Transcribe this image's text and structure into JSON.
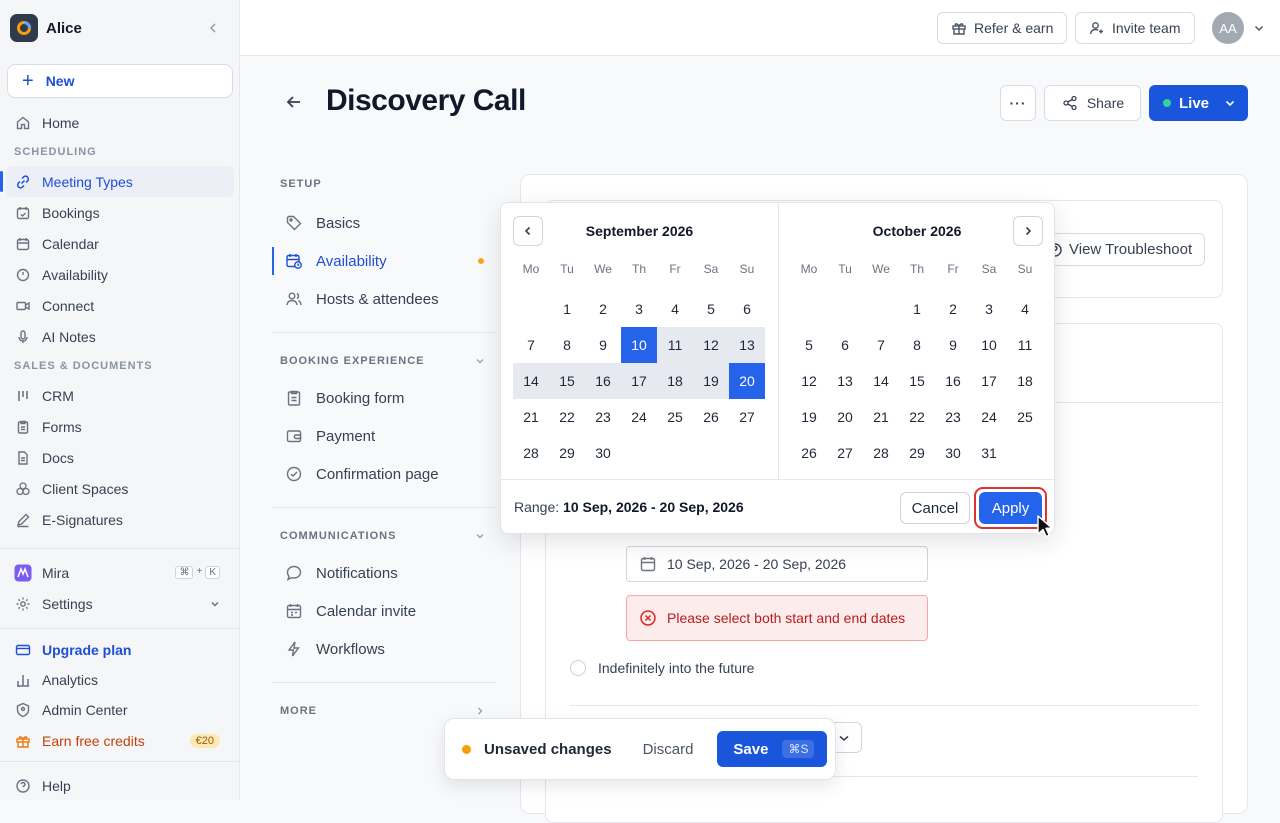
{
  "workspace": {
    "name": "Alice"
  },
  "sidebar": {
    "new_label": "New",
    "home": "Home",
    "section_scheduling": "SCHEDULING",
    "scheduling_items": [
      {
        "label": "Meeting Types",
        "icon": "link-icon",
        "active": true
      },
      {
        "label": "Bookings",
        "icon": "calendar-check-icon"
      },
      {
        "label": "Calendar",
        "icon": "calendar-icon"
      },
      {
        "label": "Availability",
        "icon": "clock-icon"
      },
      {
        "label": "Connect",
        "icon": "video-icon"
      },
      {
        "label": "AI Notes",
        "icon": "microphone-icon"
      }
    ],
    "section_sales": "SALES & DOCUMENTS",
    "sales_items": [
      {
        "label": "CRM",
        "icon": "columns-icon"
      },
      {
        "label": "Forms",
        "icon": "clipboard-icon"
      },
      {
        "label": "Docs",
        "icon": "document-icon"
      },
      {
        "label": "Client Spaces",
        "icon": "circles-icon"
      },
      {
        "label": "E-Signatures",
        "icon": "pen-icon"
      }
    ],
    "mira": "Mira",
    "mira_shortcut": [
      "⌘",
      "+",
      "K"
    ],
    "settings": "Settings",
    "upgrade": "Upgrade plan",
    "analytics": "Analytics",
    "admin": "Admin Center",
    "earn": "Earn free credits",
    "earn_badge": "€20",
    "help": "Help"
  },
  "topbar": {
    "refer": "Refer & earn",
    "invite": "Invite team",
    "avatar": "AA"
  },
  "header": {
    "title": "Discovery Call",
    "share": "Share",
    "live": "Live"
  },
  "setup_nav": {
    "section_setup": "SETUP",
    "setup_items": [
      {
        "label": "Basics",
        "icon": "tag-icon"
      },
      {
        "label": "Availability",
        "icon": "calendar-clock-icon",
        "active": true,
        "unsaved": true
      },
      {
        "label": "Hosts & attendees",
        "icon": "users-icon"
      }
    ],
    "section_booking": "BOOKING EXPERIENCE",
    "booking_items": [
      {
        "label": "Booking form",
        "icon": "clipboard-icon"
      },
      {
        "label": "Payment",
        "icon": "wallet-icon"
      },
      {
        "label": "Confirmation page",
        "icon": "check-circle-icon"
      }
    ],
    "section_comms": "COMMUNICATIONS",
    "comms_items": [
      {
        "label": "Notifications",
        "icon": "chat-bubble-icon"
      },
      {
        "label": "Calendar invite",
        "icon": "calendar-icon"
      },
      {
        "label": "Workflows",
        "icon": "lightning-icon"
      }
    ],
    "section_more": "MORE"
  },
  "content": {
    "view_troubleshoot": "View Troubleshoot",
    "date_range_value": "10 Sep, 2026 - 20 Sep, 2026",
    "error": "Please select both start and end dates",
    "indefinitely": "Indefinitely into the future"
  },
  "calendar": {
    "weekdays": [
      "Mo",
      "Tu",
      "We",
      "Th",
      "Fr",
      "Sa",
      "Su"
    ],
    "months": [
      {
        "title": "September 2026",
        "offset": 1,
        "days": 30,
        "range_start": 10,
        "range_end": 20
      },
      {
        "title": "October 2026",
        "offset": 3,
        "days": 31
      }
    ],
    "range_label": "Range:",
    "range_value": "10 Sep, 2026 - 20 Sep, 2026",
    "cancel": "Cancel",
    "apply": "Apply"
  },
  "unsaved_bar": {
    "text": "Unsaved changes",
    "discard": "Discard",
    "save": "Save",
    "shortcut": "⌘S"
  },
  "colors": {
    "accent": "#1a56db",
    "selected": "#2563eb",
    "error": "#b91c1c",
    "warning_dot": "#f59e0b"
  }
}
